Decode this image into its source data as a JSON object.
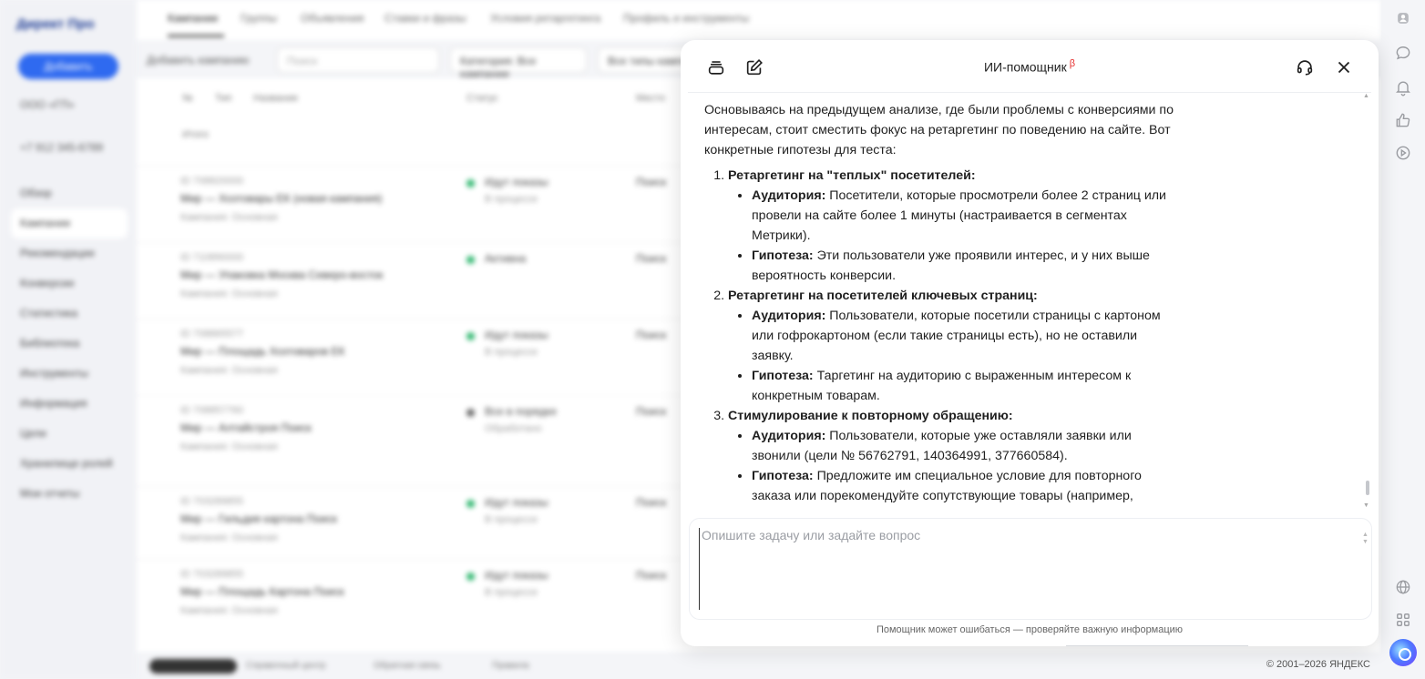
{
  "background": {
    "logo": "Директ Про",
    "create_button": "Добавить",
    "account": "ООО «ГП»",
    "phone": "+7 912 345-6789",
    "nav": [
      "Обзор",
      "Кампании",
      "Рекомендации",
      "Конверсии",
      "Статистика",
      "Библиотека",
      "Инструменты",
      "Информация",
      "Цели",
      "Хранилище ролей",
      "Мои отчеты"
    ],
    "tabs": [
      "Кампании",
      "Группы",
      "Объявления",
      "Ставки и фразы",
      "Условия ретаргетинга",
      "Профиль и инструменты"
    ],
    "toolbar_label": "Добавить кампанию",
    "search_placeholder": "Поиск",
    "filter1": "Категория: Все кампании",
    "filter2": "Все типы кампаний",
    "table_headers": [
      "№",
      "Тип",
      "Название",
      "Статус",
      "Место"
    ],
    "table_total": "Итого",
    "rows": [
      {
        "id": "ID 708820000",
        "name": "Мир — Хозтовары ЕК (новая кампания)",
        "sub": "Кампания: Основная",
        "status": "Идут показы",
        "status2": "В процессе",
        "col": "Поиск"
      },
      {
        "id": "ID 710890000",
        "name": "Мир — Упаковка Москва Северо-восток",
        "sub": "Кампания: Основная",
        "status": "Активна",
        "status2": "",
        "col": "Поиск"
      },
      {
        "id": "ID 708865577",
        "name": "Мир — Площадь Хозтоваров ЕК",
        "sub": "Кампания: Основная",
        "status": "Идут показы",
        "status2": "В процессе",
        "col": "Поиск"
      },
      {
        "id": "ID 708857760",
        "name": "Мир — Алтайстроя Поиск",
        "sub": "Кампания: Основная",
        "status": "Все в порядке",
        "status2": "Обработано",
        "col": "Поиск"
      },
      {
        "id": "ID 703289855",
        "name": "Мир — Гильдия картона Поиск",
        "sub": "Кампания: Основная",
        "status": "Идут показы",
        "status2": "В процессе",
        "col": "Поиск"
      },
      {
        "id": "ID 703289855",
        "name": "Мир — Площадь Картона Поиск",
        "sub": "Кампания: Основная",
        "status": "Идут показы",
        "status2": "В процессе",
        "col": "Поиск"
      }
    ],
    "footer_links": [
      "Справочный центр",
      "Обратная связь",
      "Правила"
    ]
  },
  "rail": {
    "icons": [
      "user-icon",
      "chat-icon",
      "bell-icon",
      "thumbs-up-icon",
      "play-icon",
      "globe-icon",
      "apps-icon",
      "alice-icon"
    ]
  },
  "copyright": "© 2001–2026 ЯНДЕКС",
  "assistant": {
    "title": "ИИ-помощник",
    "beta": "β",
    "intro": "Основываясь на предыдущем анализе, где были проблемы с конверсиями по интересам, стоит сместить фокус на ретаргетинг по поведению на сайте. Вот конкретные гипотезы для теста:",
    "items": [
      {
        "title": "Ретаргетинг на \"теплых\" посетителей:",
        "audience_label": "Аудитория:",
        "audience": " Посетители, которые просмотрели более 2 страниц или провели на сайте более 1 минуты (настраивается в сегментах Метрики).",
        "hypothesis_label": "Гипотеза:",
        "hypothesis": " Эти пользователи уже проявили интерес, и у них выше вероятность конверсии."
      },
      {
        "title": "Ретаргетинг на посетителей ключевых страниц:",
        "audience_label": "Аудитория:",
        "audience": " Пользователи, которые посетили страницы с картоном или гофрокартоном (если такие страницы есть), но не оставили заявку.",
        "hypothesis_label": "Гипотеза:",
        "hypothesis": " Таргетинг на аудиторию с выраженным интересом к конкретным товарам."
      },
      {
        "title": "Стимулирование к повторному обращению:",
        "audience_label": "Аудитория:",
        "audience": " Пользователи, которые уже оставляли заявки или звонили (цели № 56762791, 140364991, 377660584).",
        "hypothesis_label": "Гипотеза:",
        "hypothesis": " Предложите им специальное условие для повторного заказа или порекомендуйте сопутствующие товары (например,"
      }
    ],
    "input_placeholder": "Опишите задачу или задайте вопрос",
    "input_value": "",
    "disclaimer": "Помощник может ошибаться — проверяйте важную информацию"
  }
}
